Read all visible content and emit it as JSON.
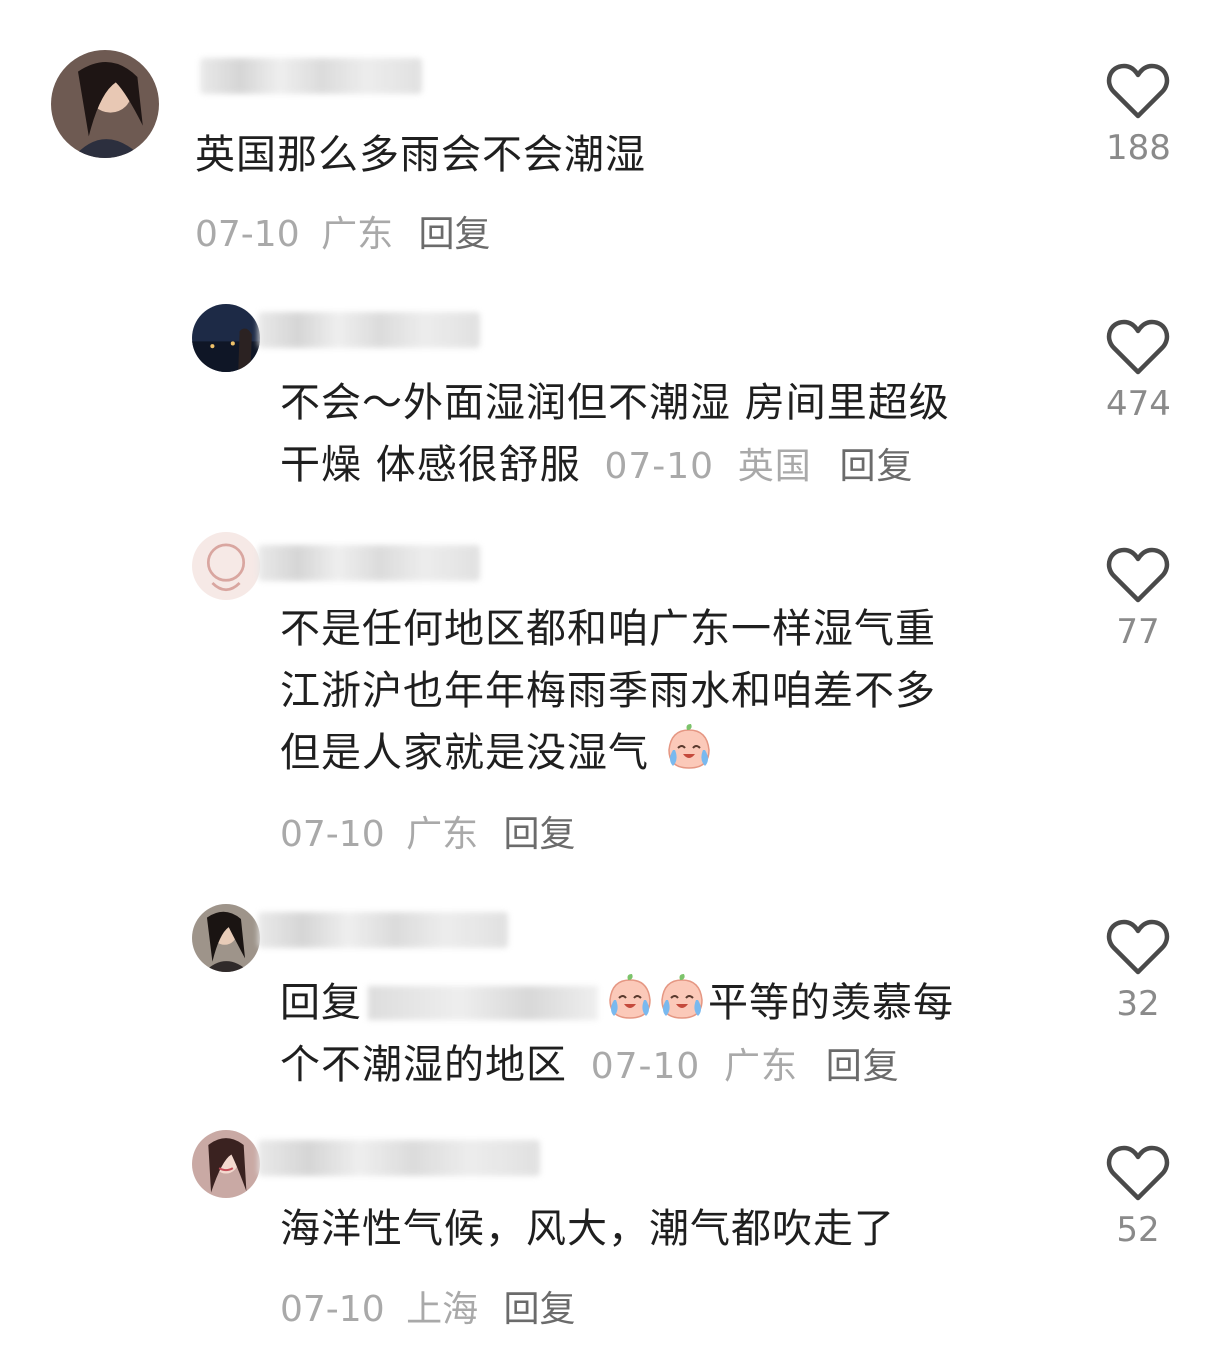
{
  "comments": [
    {
      "text": "英国那么多雨会不会潮湿",
      "date": "07-10",
      "location": "广东",
      "reply_label": "回复",
      "likes": "188"
    },
    {
      "text_line1": "不会～外面湿润但不潮湿 房间里超级",
      "text_line2": "干燥 体感很舒服",
      "date": "07-10",
      "location": "英国",
      "reply_label": "回复",
      "likes": "474"
    },
    {
      "text_line1": "不是任何地区都和咱广东一样湿气重",
      "text_line2": "江浙沪也年年梅雨季雨水和咱差不多",
      "text_line3": "但是人家就是没湿气",
      "date": "07-10",
      "location": "广东",
      "reply_label": "回复",
      "likes": "77"
    },
    {
      "reply_prefix": "回复",
      "text_line1_tail": "平等的羡慕每",
      "text_line2": "个不潮湿的地区",
      "date": "07-10",
      "location": "广东",
      "reply_label": "回复",
      "likes": "32"
    },
    {
      "text": "海洋性气候，风大，潮气都吹走了",
      "date": "07-10",
      "location": "上海",
      "reply_label": "回复",
      "likes": "52"
    }
  ],
  "icons": {
    "like": "heart-outline-icon",
    "emoji": "crying-laughing-peach-emoji"
  },
  "colors": {
    "text": "#1f1f1f",
    "meta": "#a9a9a9",
    "reply": "#6b6b6b",
    "like_count": "#8a8a8a"
  }
}
